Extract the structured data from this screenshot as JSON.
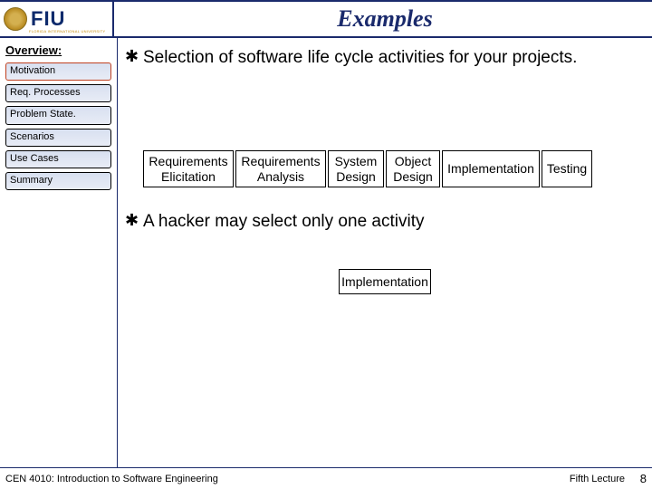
{
  "header": {
    "logo_text": "FIU",
    "logo_sub": "FLORIDA INTERNATIONAL UNIVERSITY",
    "title": "Examples"
  },
  "sidebar": {
    "title": "Overview:",
    "items": [
      {
        "label": "Motivation",
        "active": true
      },
      {
        "label": "Req. Processes",
        "active": false
      },
      {
        "label": "Problem State.",
        "active": false
      },
      {
        "label": "Scenarios",
        "active": false
      },
      {
        "label": "Use Cases",
        "active": false
      },
      {
        "label": "Summary",
        "active": false
      }
    ]
  },
  "content": {
    "bullet1": "Selection of software life cycle activities for your projects.",
    "boxes": [
      "Requirements Elicitation",
      "Requirements Analysis",
      "System Design",
      "Object Design",
      "Implementation",
      "Testing"
    ],
    "bullet2": "A hacker may select only one activity",
    "single": "Implementation"
  },
  "footer": {
    "left": "CEN 4010: Introduction to Software Engineering",
    "right": "Fifth Lecture",
    "page": "8"
  }
}
